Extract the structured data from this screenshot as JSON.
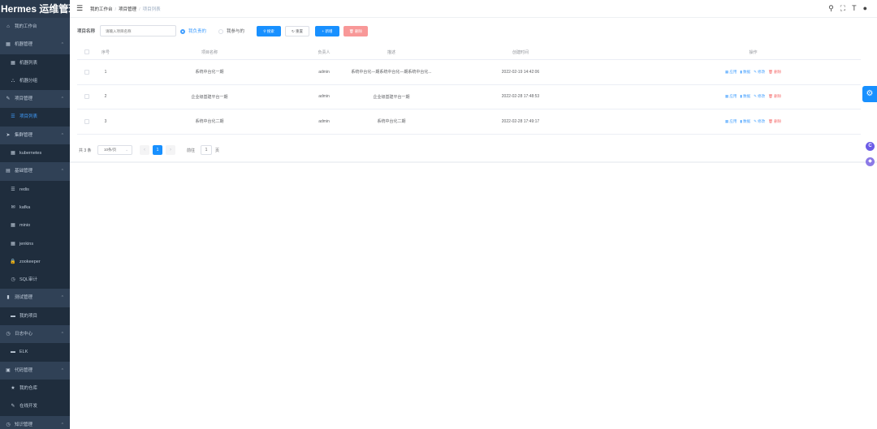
{
  "app": {
    "title": "Hermes 运维管理"
  },
  "sidebar": {
    "items": [
      {
        "label": "我的工作台",
        "icon": "dashboard-icon",
        "type": "top"
      },
      {
        "label": "机器管理",
        "icon": "grid-icon",
        "type": "group",
        "arrow": "^"
      },
      {
        "label": "机器列表",
        "icon": "grid-icon",
        "type": "sub"
      },
      {
        "label": "机器分组",
        "icon": "tree-icon",
        "type": "sub"
      },
      {
        "label": "项目管理",
        "icon": "edit-icon",
        "type": "group",
        "arrow": "^"
      },
      {
        "label": "项目列表",
        "icon": "list-icon",
        "type": "sub",
        "active": true
      },
      {
        "label": "集群管理",
        "icon": "send-icon",
        "type": "group",
        "arrow": "^"
      },
      {
        "label": "kubernetes",
        "icon": "grid-icon",
        "type": "sub"
      },
      {
        "label": "基础管理",
        "icon": "table-icon",
        "type": "group",
        "arrow": "^"
      },
      {
        "label": "redis",
        "icon": "list-icon",
        "type": "sub"
      },
      {
        "label": "kafka",
        "icon": "mail-icon",
        "type": "sub"
      },
      {
        "label": "minio",
        "icon": "grid-icon",
        "type": "sub"
      },
      {
        "label": "jenkins",
        "icon": "grid-icon",
        "type": "sub"
      },
      {
        "label": "zookeeper",
        "icon": "lock-icon",
        "type": "sub"
      },
      {
        "label": "SQL审计",
        "icon": "clock-icon",
        "type": "sub"
      },
      {
        "label": "测试管理",
        "icon": "chart-icon",
        "type": "group",
        "arrow": "^"
      },
      {
        "label": "我的项目",
        "icon": "doc-icon",
        "type": "sub"
      },
      {
        "label": "日志中心",
        "icon": "clock-icon",
        "type": "group",
        "arrow": "^"
      },
      {
        "label": "ELK",
        "icon": "doc-icon",
        "type": "sub"
      },
      {
        "label": "代码管理",
        "icon": "code-icon",
        "type": "group",
        "arrow": "^"
      },
      {
        "label": "我的仓库",
        "icon": "star-icon",
        "type": "sub"
      },
      {
        "label": "在线开发",
        "icon": "edit-icon",
        "type": "sub"
      },
      {
        "label": "知识管理",
        "icon": "clock-icon",
        "type": "group",
        "arrow": "^"
      }
    ]
  },
  "header": {
    "breadcrumb": [
      "我的工作台",
      "项目管理",
      "项目列表"
    ],
    "icons": [
      "search-icon",
      "fullscreen-icon",
      "font-size-icon",
      "user-icon"
    ]
  },
  "search": {
    "label": "项目名称",
    "placeholder": "请输入项目名称",
    "radio_mine": "我负责的",
    "radio_joined": "我参与的",
    "btn_search": "搜索",
    "btn_reset": "重置",
    "btn_add": "新增",
    "btn_delete": "删除"
  },
  "table": {
    "columns": [
      "序号",
      "项目名称",
      "负责人",
      "描述",
      "创建时间",
      "操作"
    ],
    "rows": [
      {
        "no": "1",
        "name": "系统中台化一期",
        "owner": "admin",
        "desc": "系统中台化—期系统中台化—期系统中台化...",
        "created": "2022-02-19 14:42:06"
      },
      {
        "no": "2",
        "name": "企业级基建平台一期",
        "owner": "admin",
        "desc": "企业级基建平台一期",
        "created": "2022-02-28 17:48:53"
      },
      {
        "no": "3",
        "name": "系统中台化二期",
        "owner": "admin",
        "desc": "系统中台化二期",
        "created": "2022-02-28 17:49:17"
      }
    ],
    "ops": {
      "app": "应用",
      "data": "数据",
      "edit": "修改",
      "del": "删除"
    }
  },
  "pager": {
    "total": "共 3 条",
    "size": "10条/页",
    "prev": "‹",
    "current": "1",
    "next": "›",
    "goto": "前往",
    "page_input": "1",
    "page_suffix": "页"
  },
  "colors": {
    "sidebar": "#304156",
    "primary": "#1890ff",
    "danger": "#f56c6c"
  }
}
